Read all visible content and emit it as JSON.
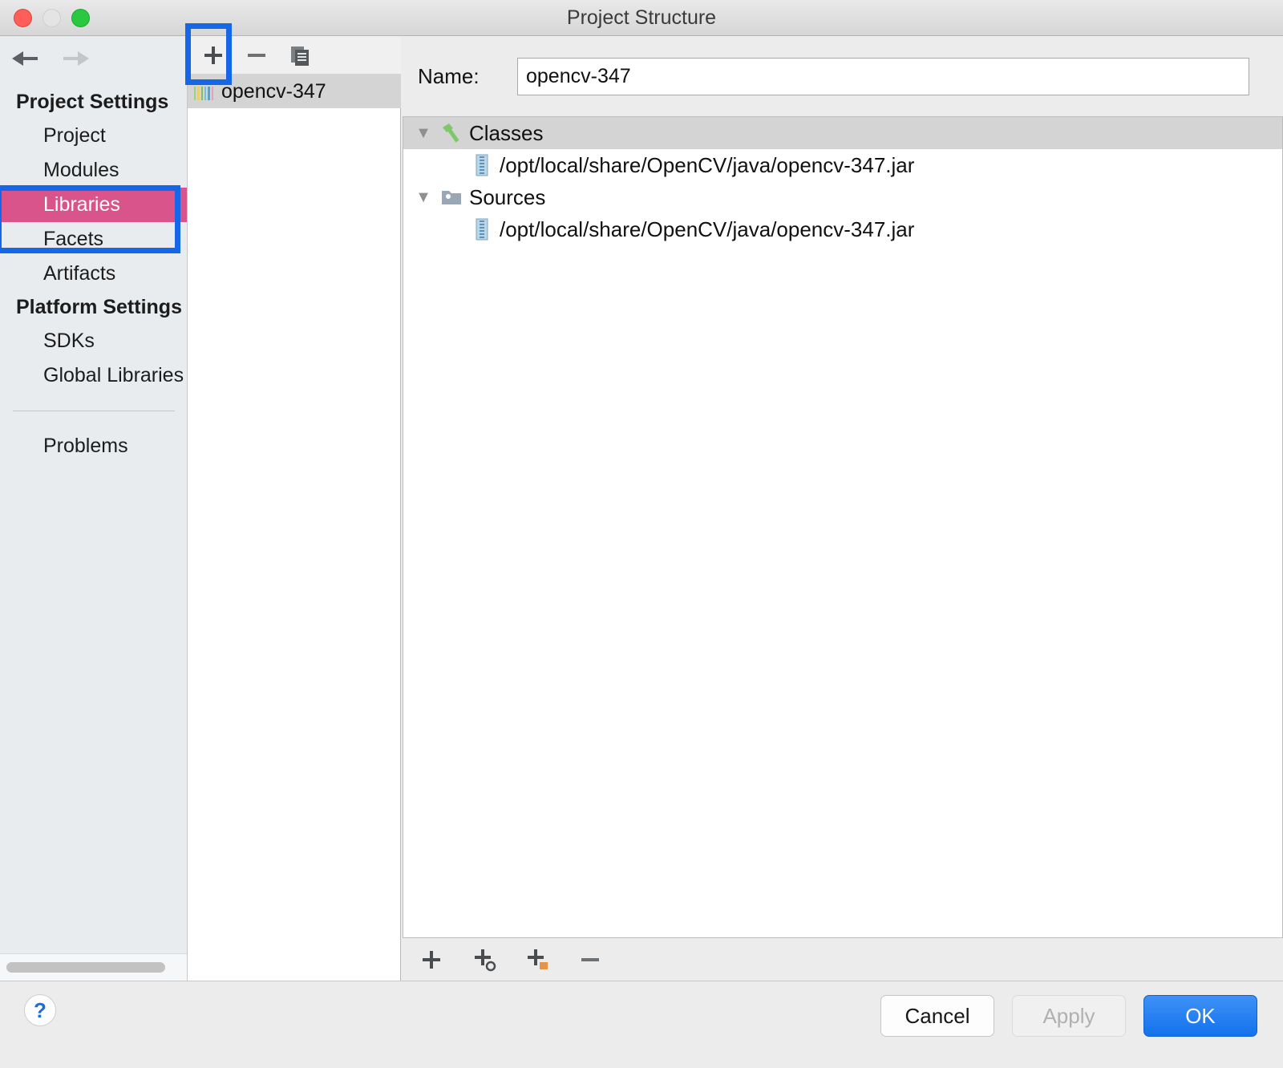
{
  "window": {
    "title": "Project Structure",
    "traffic_lights": [
      "close-red",
      "minimize-yellow",
      "maximize-green"
    ]
  },
  "sidebar": {
    "back_icon": "arrow-left-icon",
    "forward_icon": "arrow-right-icon",
    "sections": [
      {
        "heading": "Project Settings",
        "items": [
          {
            "label": "Project",
            "selected": false
          },
          {
            "label": "Modules",
            "selected": false
          },
          {
            "label": "Libraries",
            "selected": true
          },
          {
            "label": "Facets",
            "selected": false
          },
          {
            "label": "Artifacts",
            "selected": false
          }
        ]
      },
      {
        "heading": "Platform Settings",
        "items": [
          {
            "label": "SDKs",
            "selected": false
          },
          {
            "label": "Global Libraries",
            "selected": false
          }
        ]
      }
    ],
    "extra_items": [
      {
        "label": "Problems",
        "selected": false
      }
    ]
  },
  "list_panel": {
    "toolbar": [
      {
        "name": "add-library-button",
        "icon": "plus-icon",
        "label": "+"
      },
      {
        "name": "remove-library-button",
        "icon": "minus-icon",
        "label": "–"
      },
      {
        "name": "copy-library-button",
        "icon": "copy-icon",
        "label": ""
      }
    ],
    "items": [
      {
        "label": "opencv-347",
        "icon": "library-icon",
        "selected": true
      }
    ]
  },
  "detail": {
    "name_label": "Name:",
    "name_value": "opencv-347",
    "name_placeholder": "Library name",
    "tree": [
      {
        "label": "Classes",
        "icon": "hammer-icon",
        "expanded": true,
        "selected": true,
        "children": [
          {
            "label": "/opt/local/share/OpenCV/java/opencv-347.jar",
            "icon": "jar-icon"
          }
        ]
      },
      {
        "label": "Sources",
        "icon": "folder-icon",
        "expanded": true,
        "selected": false,
        "children": [
          {
            "label": "/opt/local/share/OpenCV/java/opencv-347.jar",
            "icon": "jar-icon"
          }
        ]
      }
    ],
    "bottom_toolbar": [
      {
        "name": "add-path-button",
        "icon": "plus-icon"
      },
      {
        "name": "add-url-button",
        "icon": "plus-link-icon"
      },
      {
        "name": "add-module-output-button",
        "icon": "plus-box-icon"
      },
      {
        "name": "remove-path-button",
        "icon": "minus-icon"
      }
    ]
  },
  "footer": {
    "help_label": "?",
    "cancel_label": "Cancel",
    "apply_label": "Apply",
    "ok_label": "OK"
  },
  "annotations": {
    "accent_color": "#1667e8",
    "selected_item_color": "#d9548a",
    "boxes": [
      {
        "name": "add-library-highlight",
        "target": "add-library-button"
      },
      {
        "name": "libraries-item-highlight",
        "target": "sidebar-item-libraries"
      }
    ]
  }
}
